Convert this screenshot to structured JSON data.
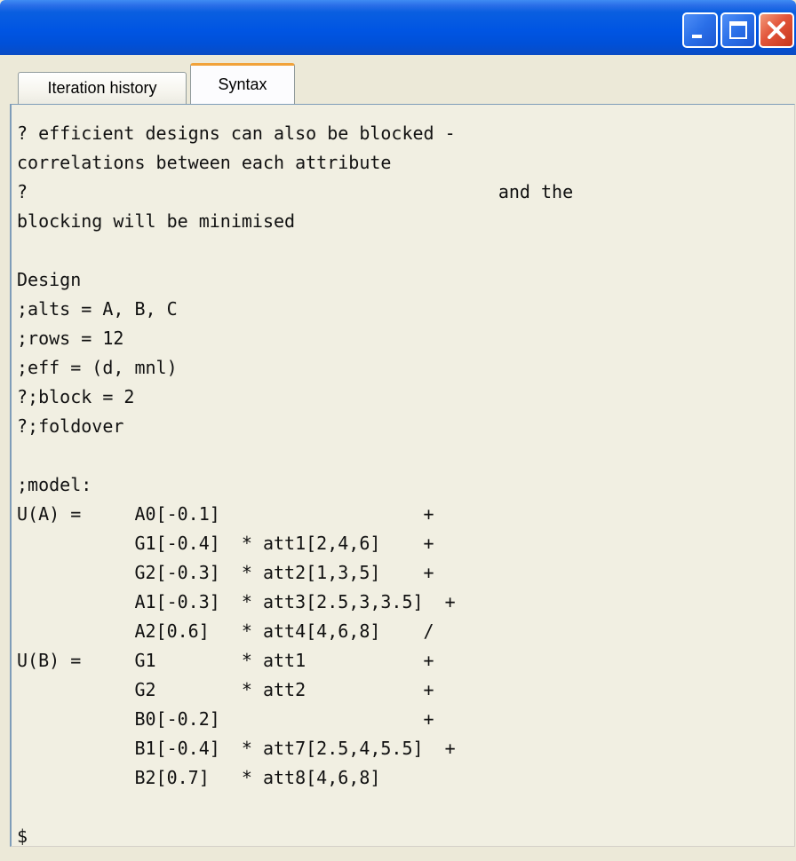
{
  "window": {
    "title": ""
  },
  "tabs": [
    {
      "label": "Iteration history",
      "active": false
    },
    {
      "label": "Syntax",
      "active": true
    }
  ],
  "editor": {
    "lines": [
      "? efficient designs can also be blocked -",
      "correlations between each attribute",
      "?                                            and the",
      "blocking will be minimised",
      "",
      "Design",
      ";alts = A, B, C",
      ";rows = 12",
      ";eff = (d, mnl)",
      "?;block = 2",
      "?;foldover",
      "",
      ";model:",
      "U(A) =     A0[-0.1]                   +",
      "           G1[-0.4]  * att1[2,4,6]    +",
      "           G2[-0.3]  * att2[1,3,5]    +",
      "           A1[-0.3]  * att3[2.5,3,3.5]  +",
      "           A2[0.6]   * att4[4,6,8]    /",
      "U(B) =     G1        * att1           +",
      "           G2        * att2           +",
      "           B0[-0.2]                   +",
      "           B1[-0.4]  * att7[2.5,4,5.5]  +",
      "           B2[0.7]   * att8[4,6,8]",
      "",
      "$"
    ]
  },
  "colors": {
    "titlebar": "#0055e3",
    "background": "#ece9d8",
    "editor_bg": "#f1efe2",
    "close_button": "#e2553a",
    "active_tab_accent": "#f1a23a"
  },
  "icons": {
    "minimize": "minimize-icon",
    "maximize": "maximize-icon",
    "close": "close-icon"
  }
}
